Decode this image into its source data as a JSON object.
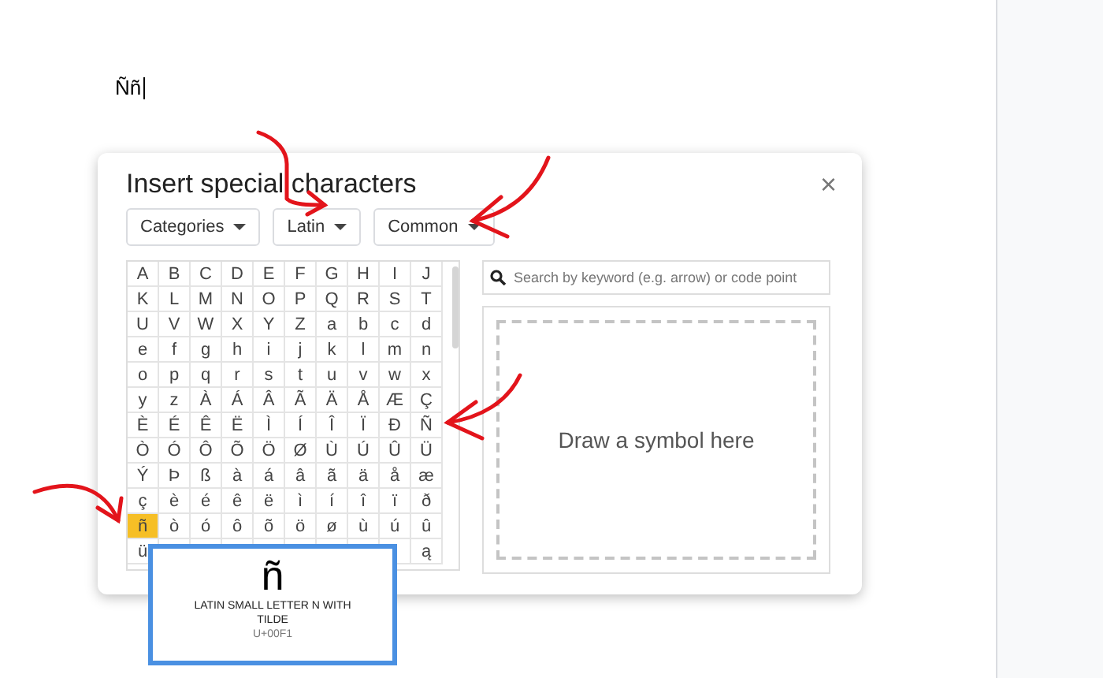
{
  "document": {
    "text": "Ññ"
  },
  "dialog": {
    "title": "Insert special characters",
    "close": "×",
    "dropdowns": [
      {
        "label": "Categories"
      },
      {
        "label": "Latin"
      },
      {
        "label": "Common"
      }
    ],
    "grid": {
      "rows": [
        [
          {
            "char": "A",
            "selected": false
          },
          {
            "char": "B",
            "selected": false
          },
          {
            "char": "C",
            "selected": false
          },
          {
            "char": "D",
            "selected": false
          },
          {
            "char": "E",
            "selected": false
          },
          {
            "char": "F",
            "selected": false
          },
          {
            "char": "G",
            "selected": false
          },
          {
            "char": "H",
            "selected": false
          },
          {
            "char": "I",
            "selected": false
          },
          {
            "char": "J",
            "selected": false
          }
        ],
        [
          {
            "char": "K",
            "selected": false
          },
          {
            "char": "L",
            "selected": false
          },
          {
            "char": "M",
            "selected": false
          },
          {
            "char": "N",
            "selected": false
          },
          {
            "char": "O",
            "selected": false
          },
          {
            "char": "P",
            "selected": false
          },
          {
            "char": "Q",
            "selected": false
          },
          {
            "char": "R",
            "selected": false
          },
          {
            "char": "S",
            "selected": false
          },
          {
            "char": "T",
            "selected": false
          }
        ],
        [
          {
            "char": "U",
            "selected": false
          },
          {
            "char": "V",
            "selected": false
          },
          {
            "char": "W",
            "selected": false
          },
          {
            "char": "X",
            "selected": false
          },
          {
            "char": "Y",
            "selected": false
          },
          {
            "char": "Z",
            "selected": false
          },
          {
            "char": "a",
            "selected": false
          },
          {
            "char": "b",
            "selected": false
          },
          {
            "char": "c",
            "selected": false
          },
          {
            "char": "d",
            "selected": false
          }
        ],
        [
          {
            "char": "e",
            "selected": false
          },
          {
            "char": "f",
            "selected": false
          },
          {
            "char": "g",
            "selected": false
          },
          {
            "char": "h",
            "selected": false
          },
          {
            "char": "i",
            "selected": false
          },
          {
            "char": "j",
            "selected": false
          },
          {
            "char": "k",
            "selected": false
          },
          {
            "char": "l",
            "selected": false
          },
          {
            "char": "m",
            "selected": false
          },
          {
            "char": "n",
            "selected": false
          }
        ],
        [
          {
            "char": "o",
            "selected": false
          },
          {
            "char": "p",
            "selected": false
          },
          {
            "char": "q",
            "selected": false
          },
          {
            "char": "r",
            "selected": false
          },
          {
            "char": "s",
            "selected": false
          },
          {
            "char": "t",
            "selected": false
          },
          {
            "char": "u",
            "selected": false
          },
          {
            "char": "v",
            "selected": false
          },
          {
            "char": "w",
            "selected": false
          },
          {
            "char": "x",
            "selected": false
          }
        ],
        [
          {
            "char": "y",
            "selected": false
          },
          {
            "char": "z",
            "selected": false
          },
          {
            "char": "À",
            "selected": false
          },
          {
            "char": "Á",
            "selected": false
          },
          {
            "char": "Â",
            "selected": false
          },
          {
            "char": "Ã",
            "selected": false
          },
          {
            "char": "Ä",
            "selected": false
          },
          {
            "char": "Å",
            "selected": false
          },
          {
            "char": "Æ",
            "selected": false
          },
          {
            "char": "Ç",
            "selected": false
          }
        ],
        [
          {
            "char": "È",
            "selected": false
          },
          {
            "char": "É",
            "selected": false
          },
          {
            "char": "Ê",
            "selected": false
          },
          {
            "char": "Ë",
            "selected": false
          },
          {
            "char": "Ì",
            "selected": false
          },
          {
            "char": "Í",
            "selected": false
          },
          {
            "char": "Î",
            "selected": false
          },
          {
            "char": "Ï",
            "selected": false
          },
          {
            "char": "Ð",
            "selected": false
          },
          {
            "char": "Ñ",
            "selected": false
          }
        ],
        [
          {
            "char": "Ò",
            "selected": false
          },
          {
            "char": "Ó",
            "selected": false
          },
          {
            "char": "Ô",
            "selected": false
          },
          {
            "char": "Õ",
            "selected": false
          },
          {
            "char": "Ö",
            "selected": false
          },
          {
            "char": "Ø",
            "selected": false
          },
          {
            "char": "Ù",
            "selected": false
          },
          {
            "char": "Ú",
            "selected": false
          },
          {
            "char": "Û",
            "selected": false
          },
          {
            "char": "Ü",
            "selected": false
          }
        ],
        [
          {
            "char": "Ý",
            "selected": false
          },
          {
            "char": "Þ",
            "selected": false
          },
          {
            "char": "ß",
            "selected": false
          },
          {
            "char": "à",
            "selected": false
          },
          {
            "char": "á",
            "selected": false
          },
          {
            "char": "â",
            "selected": false
          },
          {
            "char": "ã",
            "selected": false
          },
          {
            "char": "ä",
            "selected": false
          },
          {
            "char": "å",
            "selected": false
          },
          {
            "char": "æ",
            "selected": false
          }
        ],
        [
          {
            "char": "ç",
            "selected": false
          },
          {
            "char": "è",
            "selected": false
          },
          {
            "char": "é",
            "selected": false
          },
          {
            "char": "ê",
            "selected": false
          },
          {
            "char": "ë",
            "selected": false
          },
          {
            "char": "ì",
            "selected": false
          },
          {
            "char": "í",
            "selected": false
          },
          {
            "char": "î",
            "selected": false
          },
          {
            "char": "ï",
            "selected": false
          },
          {
            "char": "ð",
            "selected": false
          }
        ],
        [
          {
            "char": "ñ",
            "selected": true
          },
          {
            "char": "ò",
            "selected": false
          },
          {
            "char": "ó",
            "selected": false
          },
          {
            "char": "ô",
            "selected": false
          },
          {
            "char": "õ",
            "selected": false
          },
          {
            "char": "ö",
            "selected": false
          },
          {
            "char": "ø",
            "selected": false
          },
          {
            "char": "ù",
            "selected": false
          },
          {
            "char": "ú",
            "selected": false
          },
          {
            "char": "û",
            "selected": false
          }
        ]
      ],
      "last_row": {
        "first": "ü",
        "last": "ą"
      }
    },
    "search": {
      "placeholder": "Search by keyword (e.g. arrow) or code point"
    },
    "draw_area": {
      "label": "Draw a symbol here"
    },
    "tooltip": {
      "glyph": "ñ",
      "name": "LATIN SMALL LETTER N WITH TILDE",
      "code": "U+00F1"
    }
  }
}
